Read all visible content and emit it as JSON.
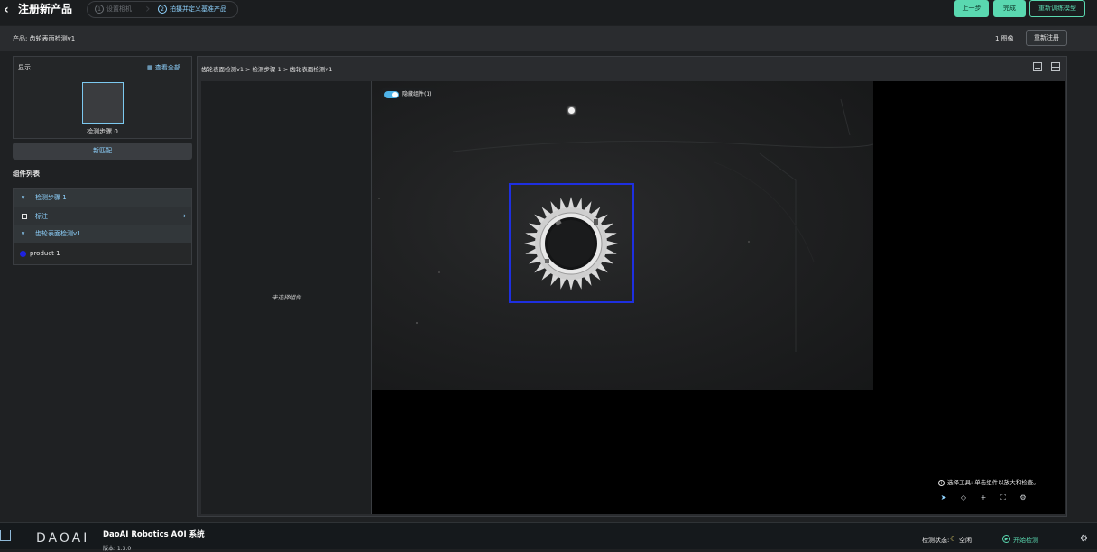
{
  "header": {
    "back_icon": "chevron-left-icon",
    "title": "注册新产品",
    "steps": [
      {
        "num": "1",
        "label": "设置相机"
      },
      {
        "num": "2",
        "label": "拍摄并定义基准产品"
      }
    ],
    "buttons": {
      "prev": "上一步",
      "done": "完成",
      "retrain": "重新训练模型"
    }
  },
  "product_bar": {
    "product": "产品: 齿轮表面检测v1",
    "image_count": "1 图像",
    "reregister": "重新注册"
  },
  "display_panel": {
    "title": "显示",
    "view_all": "查看全部",
    "thumb_label": "检测步骤 0",
    "new_match": "新匹配"
  },
  "component_list": {
    "title": "组件列表",
    "rows": [
      {
        "label": "检测步骤 1"
      },
      {
        "label": "标注"
      },
      {
        "label": "齿轮表面检测v1"
      },
      {
        "label": "product 1"
      }
    ]
  },
  "main": {
    "breadcrumb": "齿轮表面检测v1 > 检测步骤 1 > 齿轮表面检测v1",
    "no_selection": "未选择组件",
    "hide_components": "隐藏组件(1)",
    "tool_hint": "选择工具: 单击组件以放大和检查。",
    "colors": {
      "bbox": "#1e2fe0",
      "accent": "#5ad8b0",
      "link": "#8fd3ff"
    }
  },
  "footer": {
    "logo": "DAOAI",
    "app_name": "DaoAI Robotics AOI 系统",
    "version": "版本: 1.3.0",
    "status_label": "检测状态:",
    "status_value": "空闲",
    "start_detection": "开始检测"
  }
}
